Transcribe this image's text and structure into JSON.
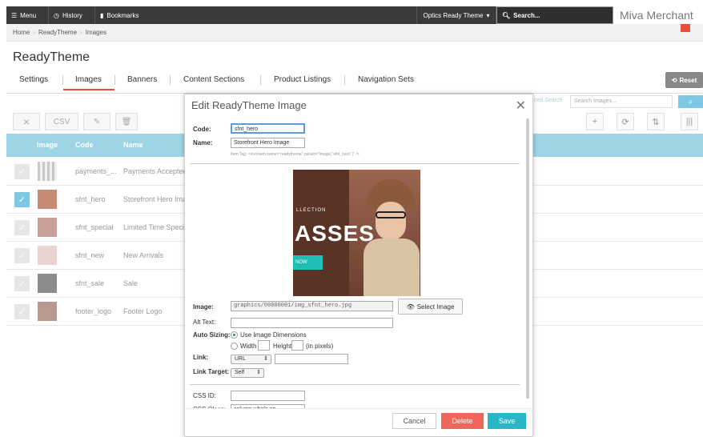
{
  "topbar": {
    "menu_label": "Menu",
    "history_label": "History",
    "bookmarks_label": "Bookmarks",
    "theme_select": "Optics Ready Theme",
    "search_label": "Search...",
    "brand": "Miva Merchant"
  },
  "breadcrumb": [
    "Home",
    "ReadyTheme",
    "Images"
  ],
  "page": {
    "title": "ReadyTheme",
    "tabs": [
      "Settings",
      "Images",
      "Banners",
      "Content Sections",
      "Product Listings",
      "Navigation Sets"
    ],
    "active_tab": "Images",
    "reset_label": "Reset"
  },
  "list": {
    "toolbar": {
      "csv_label": "CSV"
    },
    "advanced_search_label": "ced Search",
    "search_placeholder": "Search Images...",
    "columns": [
      "Image",
      "Code",
      "Name"
    ],
    "rows": [
      {
        "code": "payments_...",
        "name": "Payments Accepted",
        "selected": false
      },
      {
        "code": "sfnt_hero",
        "name": "Storefront Hero Image",
        "selected": true
      },
      {
        "code": "sfnt_special",
        "name": "Limited Time Special",
        "selected": false
      },
      {
        "code": "sfnt_new",
        "name": "New Arrivals",
        "selected": false
      },
      {
        "code": "sfnt_sale",
        "name": "Sale",
        "selected": false
      },
      {
        "code": "footer_logo",
        "name": "Footer Logo",
        "selected": false
      }
    ]
  },
  "modal": {
    "title": "Edit ReadyTheme Image",
    "code_label": "Code:",
    "code_value": "sfnt_hero",
    "name_label": "Name:",
    "name_value": "Storefront Hero Image",
    "item_tag_hint": "Item Tag: <mvt:item name=\"readytheme\" param=\"image( 'sfnt_hero' )\" />",
    "hero_text_collection": "LLECTION",
    "hero_text_big": "ASSES",
    "hero_text_cta": "NOW",
    "image_label": "Image:",
    "image_value": "graphics/00000001/img_sfnt_hero.jpg",
    "select_image_label": "Select Image",
    "alt_label": "Alt Text:",
    "alt_value": "",
    "auto_sizing_label": "Auto Sizing:",
    "use_dimensions_label": "Use Image Dimensions",
    "width_label": "Width",
    "height_label": "Height",
    "pixels_label": "(in pixels)",
    "link_label": "Link:",
    "link_type": "URL",
    "link_value": "",
    "link_target_label": "Link Target:",
    "link_target_value": "Self",
    "css_id_label": "CSS ID:",
    "css_id_value": "",
    "css_class_label": "CSS Class:",
    "css_class_value": "column whole np",
    "cancel_label": "Cancel",
    "delete_label": "Delete",
    "save_label": "Save"
  },
  "colors": {
    "accent_red": "#e74c3c",
    "accent_blue": "#7ec8e3",
    "header_blue": "#9fd4e6",
    "cta_teal": "#1fbfb8"
  }
}
